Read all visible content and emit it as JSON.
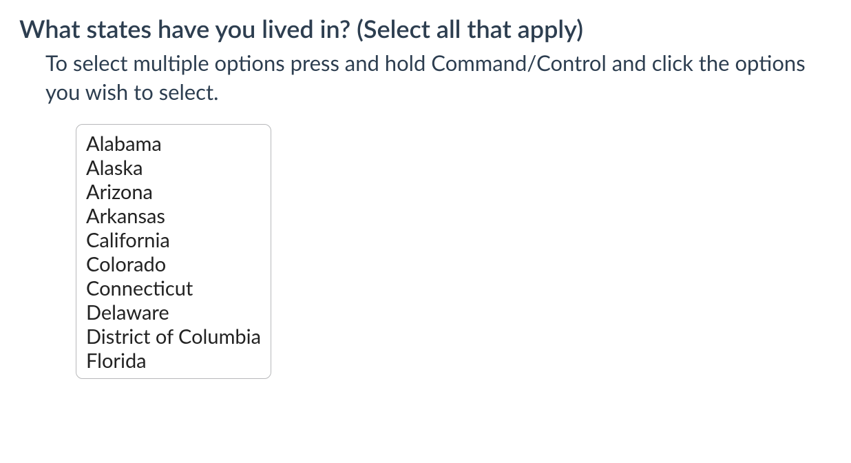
{
  "question": {
    "title": "What states have you lived in? (Select all that apply)",
    "instructions": "To select multiple options press and hold Command/Control and click the options you wish to select.",
    "options": [
      "Alabama",
      "Alaska",
      "Arizona",
      "Arkansas",
      "California",
      "Colorado",
      "Connecticut",
      "Delaware",
      "District of Columbia",
      "Florida"
    ]
  }
}
